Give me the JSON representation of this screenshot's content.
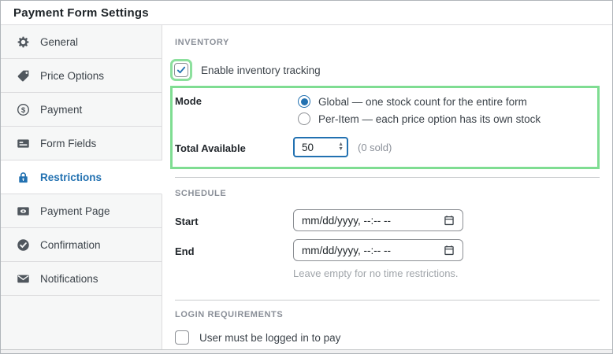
{
  "window": {
    "title": "Payment Form Settings"
  },
  "sidebar": {
    "items": [
      {
        "label": "General",
        "icon": "gear-icon",
        "active": false
      },
      {
        "label": "Price Options",
        "icon": "tag-icon",
        "active": false
      },
      {
        "label": "Payment",
        "icon": "dollar-circle-icon",
        "active": false
      },
      {
        "label": "Form Fields",
        "icon": "form-card-icon",
        "active": false
      },
      {
        "label": "Restrictions",
        "icon": "lock-icon",
        "active": true
      },
      {
        "label": "Payment Page",
        "icon": "browser-eye-icon",
        "active": false
      },
      {
        "label": "Confirmation",
        "icon": "check-circle-icon",
        "active": false
      },
      {
        "label": "Notifications",
        "icon": "envelope-icon",
        "active": false
      }
    ]
  },
  "inventory": {
    "section_title": "Inventory",
    "enable_checkbox": {
      "label": "Enable inventory tracking",
      "checked": true
    },
    "mode": {
      "label": "Mode",
      "options": [
        {
          "label": "Global — one stock count for the entire form",
          "selected": true
        },
        {
          "label": "Per-Item — each price option has its own stock",
          "selected": false
        }
      ]
    },
    "total_available": {
      "label": "Total Available",
      "value": "50",
      "note": "(0 sold)"
    }
  },
  "schedule": {
    "section_title": "Schedule",
    "start": {
      "label": "Start",
      "placeholder": "mm/dd/yyyy, --:-- --"
    },
    "end": {
      "label": "End",
      "placeholder": "mm/dd/yyyy, --:-- --"
    },
    "helper": "Leave empty for no time restrictions."
  },
  "login": {
    "section_title": "Login Requirements",
    "checkbox": {
      "label": "User must be logged in to pay",
      "checked": false
    }
  },
  "colors": {
    "accent_blue": "#2271b1",
    "highlight_green": "#7fdd92",
    "sidebar_bg": "#f6f7f7",
    "border_gray": "#dcdcde",
    "muted_text": "#8a8f98"
  }
}
